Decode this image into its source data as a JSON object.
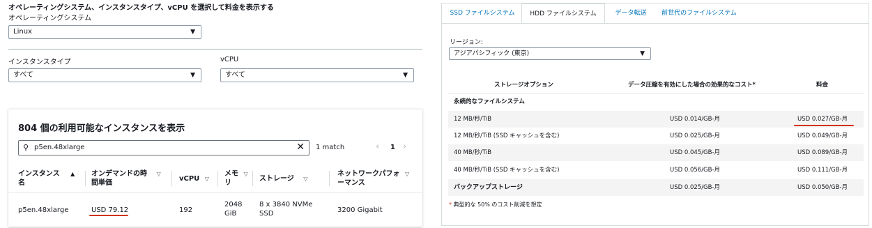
{
  "left": {
    "heading": "オペレーティングシステム、インスタンスタイプ、vCPU を選択して料金を表示する",
    "os_label": "オペレーティングシステム",
    "os_value": "Linux",
    "instance_type_label": "インスタンスタイプ",
    "instance_type_value": "すべて",
    "vcpu_label": "vCPU",
    "vcpu_value": "すべて",
    "card": {
      "title": "804 個の利用可能なインスタンスを表示",
      "search_value": "p5en.48xlarge",
      "match_text": "1 match",
      "page": "1",
      "columns": [
        "インスタンス名",
        "オンデマンドの時間単価",
        "vCPU",
        "メモリ",
        "ストレージ",
        "ネットワークパフォーマンス"
      ],
      "columns_display": {
        "c1a": "インスタンス",
        "c1b": "名",
        "c2a": "オンデマンドの時",
        "c2b": "間単価",
        "c3": "vCPU",
        "c4a": "メモ",
        "c4b": "リ",
        "c5": "ストレージ",
        "c6a": "ネットワークパフォ",
        "c6b": "ーマンス"
      },
      "row": {
        "name": "p5en.48xlarge",
        "price": "USD 79.12",
        "vcpu": "192",
        "mem_a": "2048",
        "mem_b": "GiB",
        "storage_a": "8 x 3840 NVMe",
        "storage_b": "SSD",
        "network": "3200 Gigabit"
      }
    }
  },
  "right": {
    "tabs": [
      "SSD ファイルシステム",
      "HDD ファイルシステム",
      "データ転送",
      "前世代のファイルシステム"
    ],
    "active_tab": "HDD ファイルシステム",
    "region_label": "リージョン:",
    "region_value": "アジアパシフィック (東京)",
    "headers": [
      "ストレージオプション",
      "データ圧縮を有効にした場合の効果的なコスト*",
      "料金"
    ],
    "section1": "永続的なファイルシステム",
    "rows": [
      {
        "option": "12 MB/秒/TiB",
        "effective": "USD 0.014/GB-月",
        "price": "USD 0.027/GB-月"
      },
      {
        "option": "12 MB/秒/TiB (SSD キャッシュを含む)",
        "effective": "USD 0.025/GB-月",
        "price": "USD 0.049/GB-月"
      },
      {
        "option": "40 MB/秒/TiB",
        "effective": "USD 0.045/GB-月",
        "price": "USD 0.089/GB-月"
      },
      {
        "option": "40 MB/秒/TiB (SSD キャッシュを含む)",
        "effective": "USD 0.056/GB-月",
        "price": "USD 0.111/GB-月"
      }
    ],
    "backup": {
      "option": "バックアップストレージ",
      "effective": "USD 0.025/GB-月",
      "price": "USD 0.050/GB-月"
    },
    "footnote_mark": "*",
    "footnote": " 典型的な 50% のコスト削減を想定"
  },
  "colors": {
    "link": "#0073bb",
    "underline": "#d13212",
    "border": "#d5dbdb",
    "text": "#16191f"
  }
}
